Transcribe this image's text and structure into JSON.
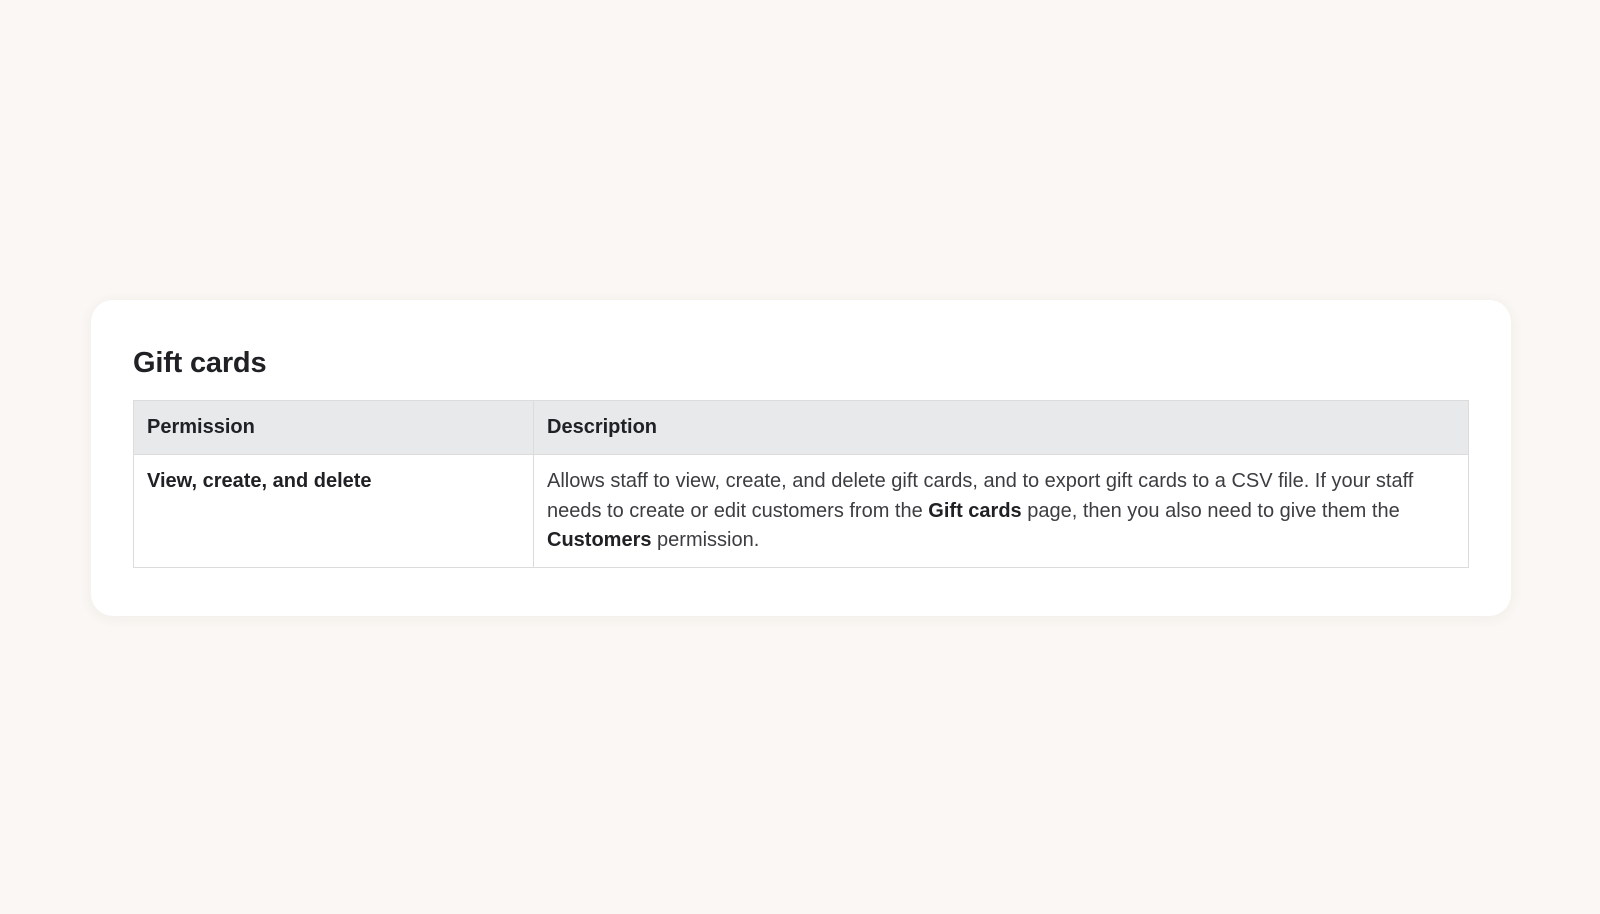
{
  "section": {
    "title": "Gift cards"
  },
  "table": {
    "headers": [
      "Permission",
      "Description"
    ],
    "rows": [
      {
        "permission": "View, create, and delete",
        "description": {
          "part1": "Allows staff to view, create, and delete gift cards, and to export gift cards to a CSV file. If your staff needs to create or edit customers from the ",
          "bold1": "Gift cards",
          "part2": " page, then you also need to give them the ",
          "bold2": "Customers",
          "part3": " permission."
        }
      }
    ]
  }
}
